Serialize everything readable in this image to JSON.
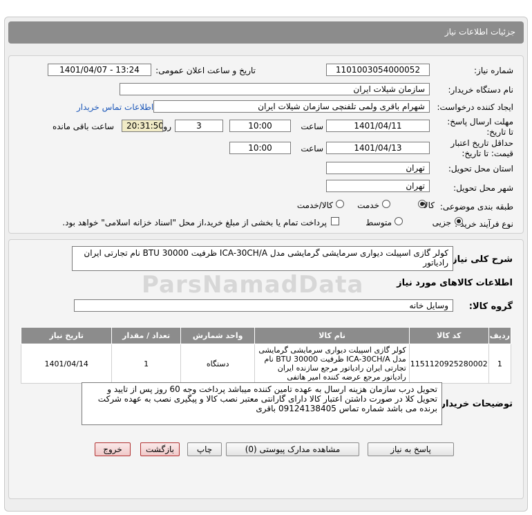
{
  "header": {
    "title": "جزئیات اطلاعات نیاز"
  },
  "form": {
    "need_number_label": "شماره نیاز:",
    "need_number": "1101003054000052",
    "announce_label": "تاریخ و ساعت اعلان عمومی:",
    "announce_value": "1401/04/07 - 13:24",
    "buyer_org_label": "نام دستگاه خریدار:",
    "buyer_org": "سازمان شیلات ایران",
    "requester_label": "ایجاد کننده درخواست:",
    "requester": "شهرام باقری ولمی تلفنچی سازمان شیلات ایران",
    "buyer_contact_link": "اطلاعات تماس خریدار",
    "deadline_label": "مهلت ارسال پاسخ: تا تاریخ:",
    "deadline_date": "1401/04/11",
    "time_label": "ساعت",
    "deadline_time": "10:00",
    "days_value": "3",
    "days_label": "روز و",
    "remaining_time": "20:31:50",
    "remaining_label": "ساعت باقی مانده",
    "validity_label": "حداقل تاریخ اعتبار قیمت: تا تاریخ:",
    "validity_date": "1401/04/13",
    "validity_time": "10:00",
    "delivery_province_label": "استان محل تحویل:",
    "delivery_province": "تهران",
    "delivery_city_label": "شهر محل تحویل:",
    "delivery_city": "تهران",
    "category_label": "طبقه بندی موضوعی:",
    "category_options": [
      "کالا",
      "خدمت",
      "کالا/خدمت"
    ],
    "process_label": "نوع فرآیند خرید :",
    "process_options": [
      "جزیی",
      "متوسط"
    ],
    "payment_note": "پرداخت تمام یا بخشی از مبلغ خرید،از محل \"اسناد خزانه اسلامی\" خواهد بود."
  },
  "summary": {
    "label": "شرح کلی نیاز:",
    "text": "کولر گازی اسپیلت دیواری سرمایشی گرمایشی مدل ICA-30CH/A ظرفیت BTU 30000 نام تجارتی ایران رادیاتور",
    "goods_info_title": "اطلاعات کالاهای مورد نیاز",
    "goods_group_label": "گروه کالا:",
    "goods_group": "وسایل خانه"
  },
  "table": {
    "headers": [
      "ردیف",
      "کد کالا",
      "نام کالا",
      "واحد شمارش",
      "تعداد / مقدار",
      "تاریخ نیاز"
    ],
    "rows": [
      {
        "index": "1",
        "code": "1151120925280002",
        "name": "کولر گازی اسپیلت دیواری سرمایشی گرمایشی مدل ICA-30CH/A ظرفیت BTU 30000 نام تجارتی ایران رادیاتور مرجع سازنده ایران رادیاتور مرجع عرضه کننده امیر هاتفی",
        "unit": "دستگاه",
        "qty": "1",
        "date": "1401/04/14"
      }
    ]
  },
  "buyer_notes": {
    "label": "توضیحات خریدار:",
    "text": "تحویل درب سازمان هزینه ارسال به عهده تامین کننده میباشد پرداخت وجه 60 روز پس از تایید و تحویل کلا در صورت داشتن اعتبار   کالا دارای گارانتی معتبر نصب کالا و پیگیری نصب به عهده شرکت برنده می باشد شماره تماس 09124138405 باقری"
  },
  "buttons": {
    "reply": "پاسخ به نیاز",
    "attachments": "مشاهده مدارک پیوستی (0)",
    "print": "چاپ",
    "back": "بازگشت",
    "exit": "خروج"
  },
  "watermark": "ParsNamadData"
}
